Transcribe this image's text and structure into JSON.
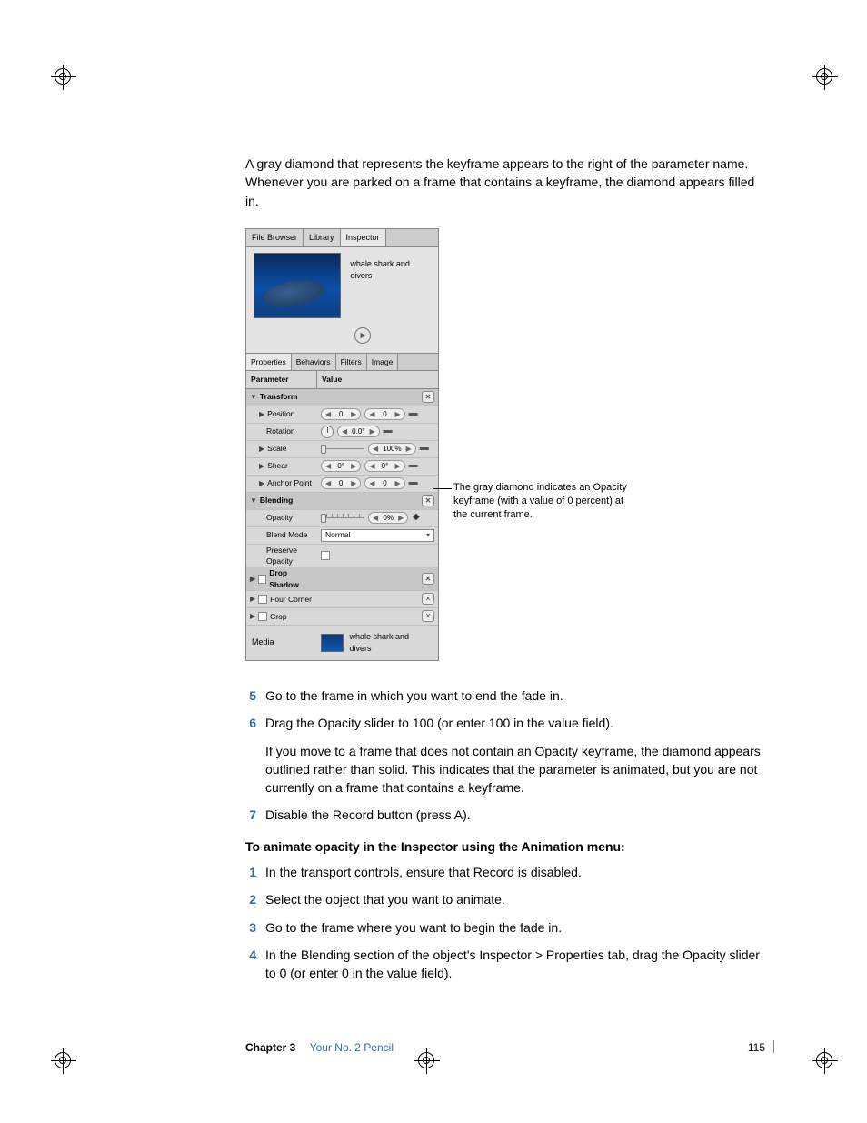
{
  "intro": "A gray diamond that represents the keyframe appears to the right of the parameter name. Whenever you are parked on a frame that contains a keyframe, the diamond appears filled in.",
  "inspector": {
    "top_tabs": [
      "File Browser",
      "Library",
      "Inspector"
    ],
    "top_active": 2,
    "clip_name": "whale shark and divers",
    "sub_tabs": [
      "Properties",
      "Behaviors",
      "Filters",
      "Image"
    ],
    "sub_active": 0,
    "col_parameter": "Parameter",
    "col_value": "Value",
    "sections": {
      "transform": {
        "label": "Transform",
        "position": {
          "label": "Position",
          "x": "0",
          "y": "0"
        },
        "rotation": {
          "label": "Rotation",
          "value": "0.0°"
        },
        "scale": {
          "label": "Scale",
          "value": "100%"
        },
        "shear": {
          "label": "Shear",
          "x": "0°",
          "y": "0°"
        },
        "anchor": {
          "label": "Anchor Point",
          "x": "0",
          "y": "0"
        }
      },
      "blending": {
        "label": "Blending",
        "opacity": {
          "label": "Opacity",
          "value": "0%"
        },
        "blend_mode": {
          "label": "Blend Mode",
          "value": "Normal"
        },
        "preserve": {
          "label": "Preserve Opacity"
        }
      },
      "drop_shadow": {
        "label": "Drop Shadow"
      },
      "four_corner": {
        "label": "Four Corner"
      },
      "crop": {
        "label": "Crop"
      }
    },
    "media_label": "Media",
    "media_value": "whale shark and divers"
  },
  "callout": "The gray diamond indicates an Opacity keyframe (with a value of 0 percent) at the current frame.",
  "steps_a": [
    {
      "n": "5",
      "t": "Go to the frame in which you want to end the fade in."
    },
    {
      "n": "6",
      "t": "Drag the Opacity slider to 100 (or enter 100 in the value field).",
      "note": "If you move to a frame that does not contain an Opacity keyframe, the diamond appears outlined rather than solid. This indicates that the parameter is animated, but you are not currently on a frame that contains a keyframe."
    },
    {
      "n": "7",
      "t": "Disable the Record button (press A)."
    }
  ],
  "subhead": "To animate opacity in the Inspector using the Animation menu:",
  "steps_b": [
    {
      "n": "1",
      "t": "In the transport controls, ensure that Record is disabled."
    },
    {
      "n": "2",
      "t": "Select the object that you want to animate."
    },
    {
      "n": "3",
      "t": "Go to the frame where you want to begin the fade in."
    },
    {
      "n": "4",
      "t": "In the Blending section of the object's Inspector > Properties tab, drag the Opacity slider to 0 (or enter 0 in the value field)."
    }
  ],
  "footer": {
    "chapter": "Chapter 3",
    "title": "Your No. 2 Pencil",
    "page": "115"
  }
}
